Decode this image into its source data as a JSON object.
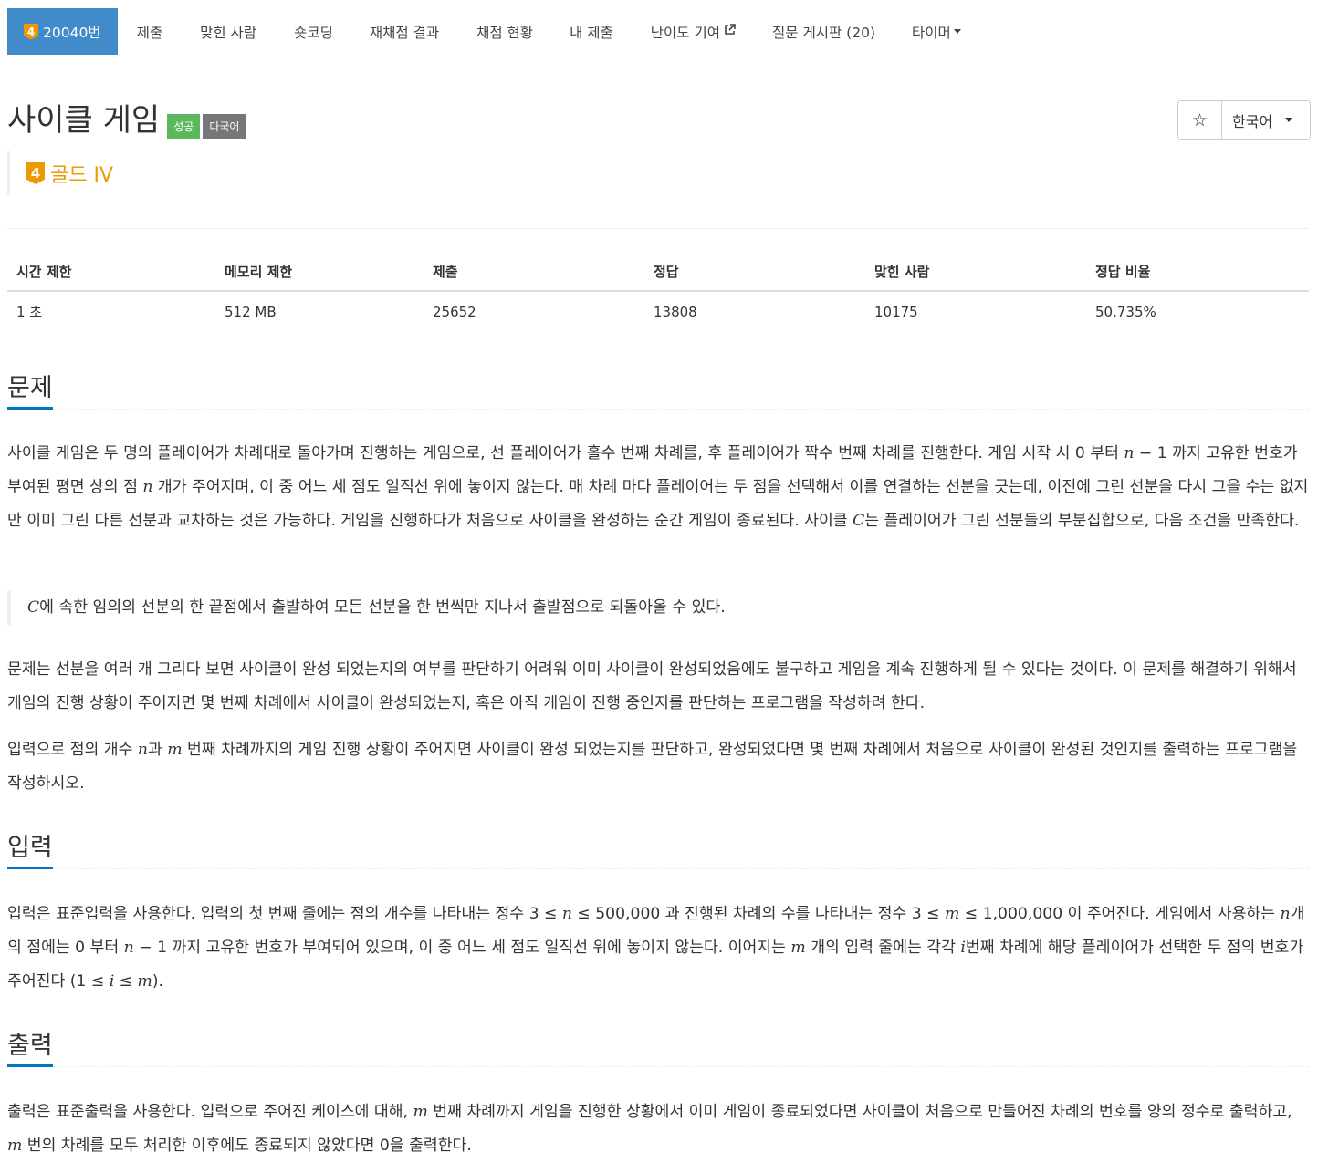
{
  "nav": {
    "problem_tab": {
      "tier_num": "4",
      "label": "20040번"
    },
    "items": [
      {
        "label": "제출"
      },
      {
        "label": "맞힌 사람"
      },
      {
        "label": "숏코딩"
      },
      {
        "label": "재채점 결과"
      },
      {
        "label": "채점 현황"
      },
      {
        "label": "내 제출"
      },
      {
        "label": "난이도 기여"
      },
      {
        "label": "질문 게시판 (20)"
      },
      {
        "label": "타이머"
      }
    ]
  },
  "problem": {
    "title": "사이클 게임",
    "labels": [
      "성공",
      "다국어"
    ],
    "tier_num": "4",
    "tier_text": "골드 IV",
    "language": "한국어",
    "star": "☆"
  },
  "stats": {
    "headers": [
      "시간 제한",
      "메모리 제한",
      "제출",
      "정답",
      "맞힌 사람",
      "정답 비율"
    ],
    "values": [
      "1 초",
      "512 MB",
      "25652",
      "13808",
      "10175",
      "50.735%"
    ]
  },
  "sections": {
    "problem": {
      "heading": "문제",
      "p1": [
        "사이클 게임은 두 명의 플레이어가 차례대로 돌아가며 진행하는 게임으로, 선 플레이어가 홀수 번째 차례를, 후 플레이어가 짝수 번째 차례를 진행한다. 게임 시작 시 0 부터 ",
        "n",
        " − 1 까지 고유한 번호가 부여된 평면 상의 점 ",
        "n",
        " 개가 주어지며, 이 중 어느 세 점도 일직선 위에 놓이지 않는다. 매 차례 마다 플레이어는 두 점을 선택해서 이를 연결하는 선분을 긋는데, 이전에 그린 선분을 다시 그을 수는 없지만 이미 그린 다른 선분과 교차하는 것은 가능하다. 게임을 진행하다가 처음으로 사이클을 완성하는 순간 게임이 종료된다. 사이클 ",
        "C",
        "는 플레이어가 그린 선분들의 부분집합으로, 다음 조건을 만족한다."
      ],
      "quote": [
        "C",
        "에 속한 임의의 선분의 한 끝점에서 출발하여 모든 선분을 한 번씩만 지나서 출발점으로 되돌아올 수 있다."
      ],
      "p2": "문제는 선분을 여러 개 그리다 보면 사이클이 완성 되었는지의 여부를 판단하기 어려워 이미 사이클이 완성되었음에도 불구하고 게임을 계속 진행하게 될 수 있다는 것이다. 이 문제를 해결하기 위해서 게임의 진행 상황이 주어지면 몇 번째 차례에서 사이클이 완성되었는지, 혹은 아직 게임이 진행 중인지를 판단하는 프로그램을 작성하려 한다.",
      "p3": [
        "입력으로 점의 개수 ",
        "n",
        "과 ",
        "m",
        " 번째 차례까지의 게임 진행 상황이 주어지면 사이클이 완성 되었는지를 판단하고, 완성되었다면 몇 번째 차례에서 처음으로 사이클이 완성된 것인지를 출력하는 프로그램을 작성하시오."
      ]
    },
    "input": {
      "heading": "입력",
      "p": [
        "입력은 표준입력을 사용한다. 입력의 첫 번째 줄에는 점의 개수를 나타내는 정수 3 ≤ ",
        "n",
        " ≤ 500,000 과 진행된 차례의 수를 나타내는 정수 3 ≤ ",
        "m",
        " ≤ 1,000,000 이 주어진다. 게임에서 사용하는 ",
        "n",
        "개의 점에는 0 부터 ",
        "n",
        " − 1 까지 고유한 번호가 부여되어 있으며, 이 중 어느 세 점도 일직선 위에 놓이지 않는다. 이어지는 ",
        "m",
        " 개의 입력 줄에는 각각 ",
        "i",
        "번째 차례에 해당 플레이어가 선택한 두 점의 번호가 주어진다 (1 ≤ ",
        "i",
        " ≤ ",
        "m",
        ")."
      ]
    },
    "output": {
      "heading": "출력",
      "p": [
        "출력은 표준출력을 사용한다. 입력으로 주어진 케이스에 대해, ",
        "m",
        " 번째 차례까지 게임을 진행한 상황에서 이미 게임이 종료되었다면 사이클이 처음으로 만들어진 차례의 번호를 양의 정수로 출력하고, ",
        "m",
        " 번의 차례를 모두 처리한 이후에도 종료되지 않았다면 0을 출력한다."
      ]
    }
  }
}
